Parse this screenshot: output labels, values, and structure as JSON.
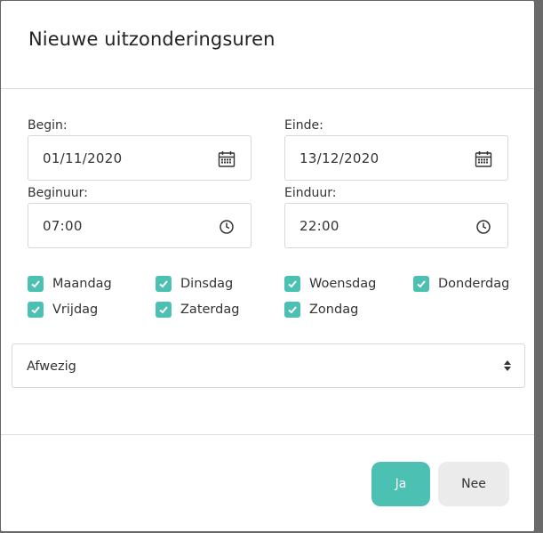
{
  "modal": {
    "title": "Nieuwe uitzonderingsuren"
  },
  "form": {
    "begin_label": "Begin:",
    "begin_value": "01/11/2020",
    "end_label": "Einde:",
    "end_value": "13/12/2020",
    "start_time_label": "Beginuur:",
    "start_time_value": "07:00",
    "end_time_label": "Einduur:",
    "end_time_value": "22:00",
    "days": [
      {
        "label": "Maandag",
        "checked": true
      },
      {
        "label": "Dinsdag",
        "checked": true
      },
      {
        "label": "Woensdag",
        "checked": true
      },
      {
        "label": "Donderdag",
        "checked": true
      },
      {
        "label": "Vrijdag",
        "checked": true
      },
      {
        "label": "Zaterdag",
        "checked": true
      },
      {
        "label": "Zondag",
        "checked": true
      }
    ],
    "status_select": {
      "value": "Afwezig"
    }
  },
  "footer": {
    "yes_label": "Ja",
    "no_label": "Nee"
  },
  "colors": {
    "accent": "#4cc1b3",
    "secondary_button": "#ebebeb",
    "border": "#d8d8d8",
    "divider": "#dcdcdc"
  },
  "icons": {
    "date_field": "calendar-icon",
    "time_field": "clock-icon",
    "checkbox": "checkmark-icon",
    "select": "sort-arrows-icon"
  }
}
